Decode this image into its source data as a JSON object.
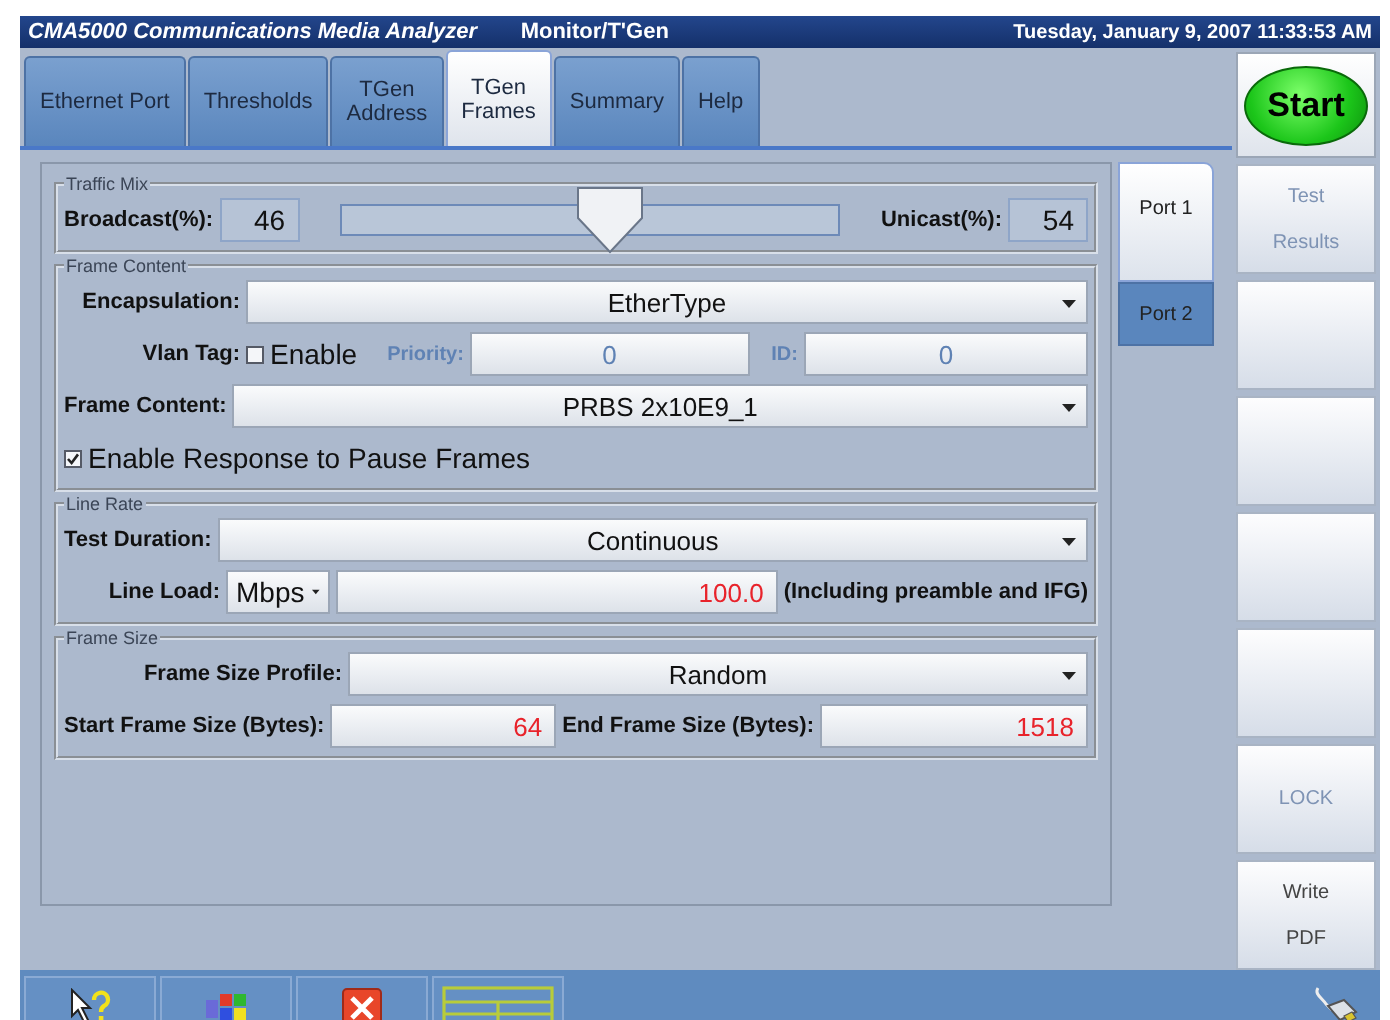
{
  "title_bar": {
    "app_title": "CMA5000 Communications Media Analyzer",
    "mode": "Monitor/T'Gen",
    "datetime": "Tuesday, January 9, 2007 11:33:53 AM"
  },
  "tabs": [
    {
      "label": "Ethernet Port",
      "selected": false
    },
    {
      "label": "Thresholds",
      "selected": false
    },
    {
      "label": "TGen\nAddress",
      "selected": false
    },
    {
      "label": "TGen\nFrames",
      "selected": true
    },
    {
      "label": "Summary",
      "selected": false
    },
    {
      "label": "Help",
      "selected": false
    }
  ],
  "start_button": {
    "label": "Start"
  },
  "side_buttons": [
    {
      "kind": "text",
      "label": "Test\nResults",
      "disabled": true
    },
    {
      "kind": "blank"
    },
    {
      "kind": "blank"
    },
    {
      "kind": "blank"
    },
    {
      "kind": "blank"
    },
    {
      "kind": "text",
      "label": "LOCK",
      "disabled": true
    },
    {
      "kind": "text",
      "label": "Write\nPDF",
      "disabled": false
    }
  ],
  "port_tabs": [
    {
      "label": "Port 1",
      "selected": true
    },
    {
      "label": "Port 2",
      "selected": false
    }
  ],
  "traffic_mix": {
    "legend": "Traffic Mix",
    "broadcast_label": "Broadcast(%):",
    "broadcast_value": "46",
    "level": 0.54,
    "unicast_label": "Unicast(%):",
    "unicast_value": "54"
  },
  "frame_content": {
    "legend": "Frame Content",
    "encapsulation": {
      "label": "Encapsulation:",
      "value": "EtherType"
    },
    "vlan_tag": {
      "label": "Vlan Tag:",
      "checkbox_label": "Enable",
      "checked": false,
      "priority_label": "Priority:",
      "priority_value": "0",
      "id_label": "ID:",
      "id_value": "0",
      "disabled": true
    },
    "frame_content": {
      "label": "Frame Content:",
      "value": "PRBS 2x10E9_1"
    },
    "pause_frames": {
      "label": "Enable Response to Pause Frames",
      "checked": true
    }
  },
  "line_rate": {
    "legend": "Line Rate",
    "test_duration": {
      "label": "Test Duration:",
      "value": "Continuous"
    },
    "line_load": {
      "label": "Line Load:",
      "unit": "Mbps",
      "value": "100.0",
      "note": "(Including preamble and IFG)"
    }
  },
  "frame_size": {
    "legend": "Frame Size",
    "profile": {
      "label": "Frame Size Profile:",
      "value": "Random"
    },
    "start": {
      "label": "Start Frame Size (Bytes):",
      "value": "64"
    },
    "end": {
      "label": "End Frame Size (Bytes):",
      "value": "1518"
    }
  }
}
